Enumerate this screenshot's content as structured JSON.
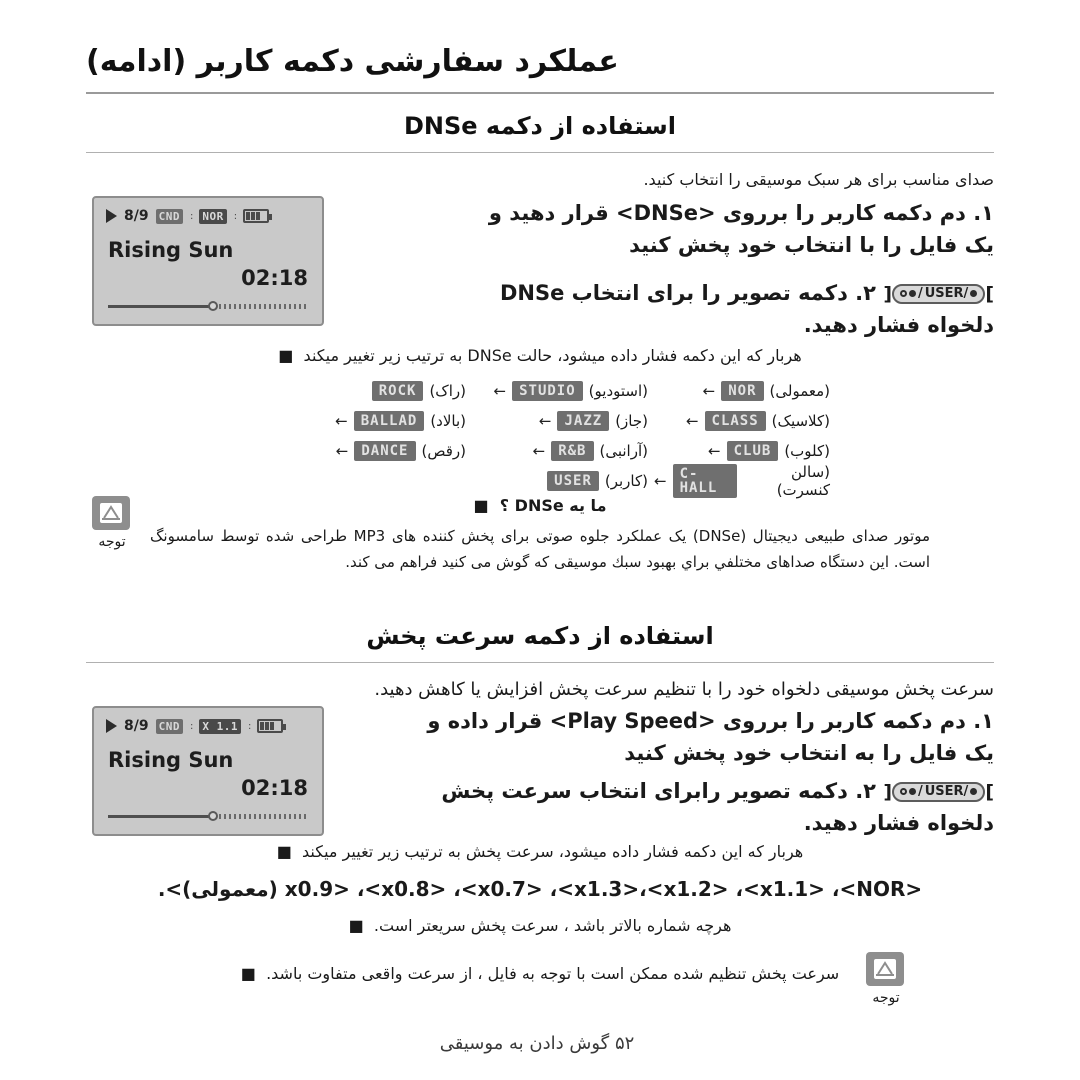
{
  "header": {
    "title": "عملکرد سفارشی دکمه کاربر (ادامه)"
  },
  "sections": [
    {
      "heading": "استفاده از دکمه DNSe",
      "lead": "صدای مناسب برای هر سبک موسیقی را انتخاب کنید.",
      "steps": [
        "۱.  دم دکمه کاربر را برروی <DNSe> قرار دهید و یک فایل را با انتخاب خود پخش کنید",
        "۲.  دکمه تصویر را برای انتخاب DNSe دلخواه فشار دهید."
      ],
      "bullet": "هربار که این دکمه فشار داده میشود، حالت DNSe به ترتیب زیر تغییر میکند",
      "note_title": "ما یه DNSe ؟",
      "note_caption": "توجه",
      "note_text": "موتور صدای طبیعی دیجیتال (DNSe) یک عملکرد جلوه صوتی برای پخش کننده های MP3 طراحی شده توسط سامسونگ است. این دستگاه صداهای مختلفي براي بهبود سبك موسیقی که گوش می کنید فراهم می کند."
    },
    {
      "heading": "استفاده از دکمه سرعت پخش",
      "lead": "سرعت پخش موسیقی دلخواه خود را با تنظیم سرعت پخش افزایش یا کاهش دهید.",
      "steps": [
        "۱.  دم دکمه کاربر را برروی <Play Speed> قرار داده و یک فایل را به انتخاب خود پخش کنید",
        "۲.  دکمه تصویر رابرای انتخاب سرعت پخش دلخواه فشار دهید."
      ],
      "bullet": "هربار که این دکمه فشار داده میشود، سرعت پخش به ترتیب زیر تغییر میکند",
      "speed_list": "<x0.9> ،<x0.8> ،<x0.7> ،<x1.3>،<x1.2> ،<x1.1> ،<NOR (معمولی)>.",
      "bullet2": "هرچه شماره بالاتر باشد ، سرعت پخش سریعتر است.",
      "note_caption": "توجه",
      "note_text": "سرعت پخش تنظیم شده ممکن است با توجه به فایل ،  از سرعت واقعی متفاوت باشد."
    }
  ],
  "eq_table": {
    "rows": [
      [
        {
          "badge": "NOR",
          "label": "(معمولی)",
          "arrow": "←"
        },
        {
          "badge": "STUDIO",
          "label": "(استودیو)",
          "arrow": "←"
        },
        {
          "badge": "ROCK",
          "label": "(راک)",
          "arrow": "←"
        }
      ],
      [
        {
          "badge": "CLASS",
          "label": "(کلاسیک)",
          "arrow": "←"
        },
        {
          "badge": "JAZZ",
          "label": "(جاز)",
          "arrow": "←"
        },
        {
          "badge": "BALLAD",
          "label": "(بالاد)",
          "arrow": "←"
        }
      ],
      [
        {
          "badge": "CLUB",
          "label": "(کلوب)",
          "arrow": "←"
        },
        {
          "badge": "R&B",
          "label": "(آرانبی)",
          "arrow": "←"
        },
        {
          "badge": "DANCE",
          "label": "(رقص)",
          "arrow": "←"
        }
      ],
      [
        {
          "badge": "C-HALL",
          "label": "(سالن کنسرت)",
          "arrow": "←"
        },
        {
          "badge": "USER",
          "label": "(کاربر)",
          "arrow": ""
        }
      ]
    ]
  },
  "devices": [
    {
      "count": "8/9",
      "chip1": "CND",
      "chip2": "NOR",
      "song": "Rising Sun",
      "time": "02:18"
    },
    {
      "count": "8/9",
      "chip1": "CND",
      "chip2": "X 1.1",
      "song": "Rising Sun",
      "time": "02:18"
    }
  ],
  "button_glyph": {
    "label": "USER/"
  },
  "footer": {
    "page": "۵۲",
    "text": "گوش دادن به موسیقی"
  },
  "colors": {
    "badge_bg": "#6f6f6f",
    "device_bg": "#c9c9c9",
    "note_bg": "#8e8e8e"
  }
}
